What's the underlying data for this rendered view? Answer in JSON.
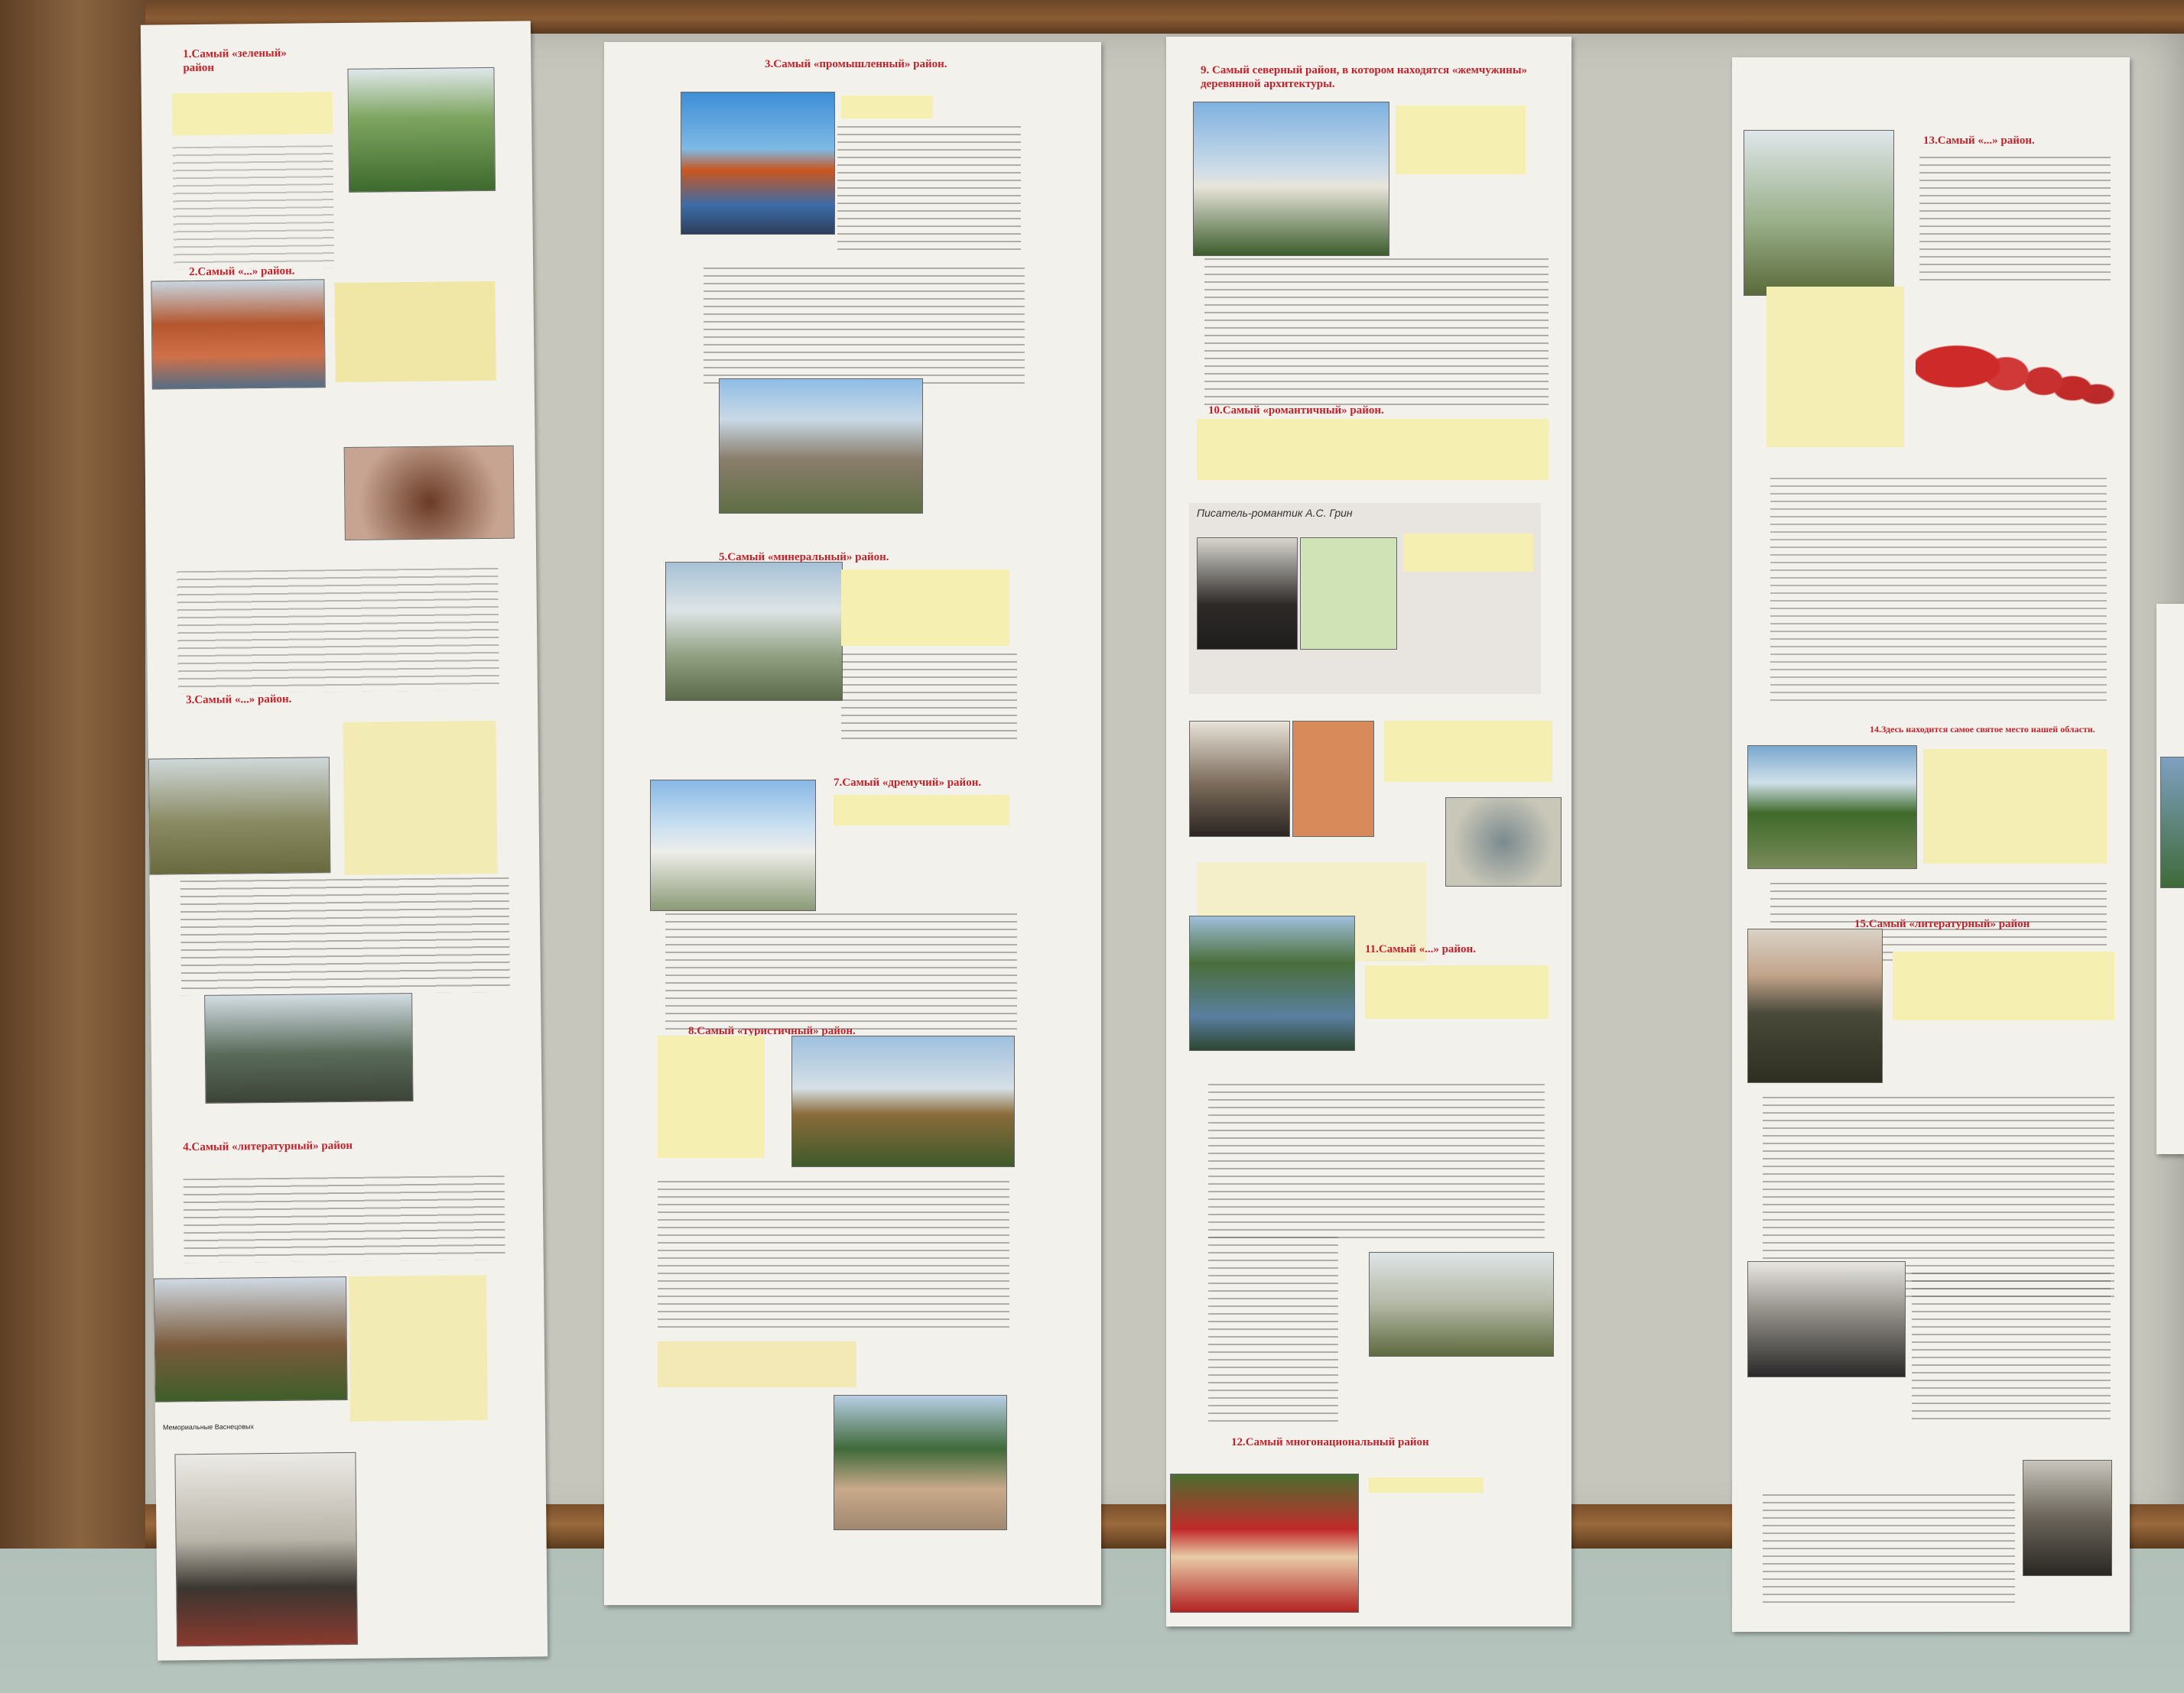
{
  "scene": "photo-of-wall-display",
  "colors": {
    "paper": "#f3f1ec",
    "heading_red": "#c2222b",
    "highlight_yellow": "#f6efb2",
    "wood": "#8a5c33",
    "board": "#c7c6bd"
  },
  "sheets": {
    "col1": {
      "h1": "1.Самый «зеленый» район",
      "h2": "2.Самый «...» район.",
      "h3": "3.Самый «...» район.",
      "h4": "4.Самый «литературный» район",
      "caption": "Мемориальные Васнецовых"
    },
    "col2": {
      "h1": "3.Самый «промышленный» район.",
      "h2": "5.Самый «минеральный» район.",
      "h3": "7.Самый «дремучий» район.",
      "h4": "8.Самый «туристичный» район."
    },
    "col3": {
      "h1": "9. Самый северный район, в котором находятся «жемчужины» деревянной архитектуры.",
      "h2": "10.Самый «романтичный» район.",
      "green_title": "Писатель-романтик А.С. Грин",
      "h3": "11.Самый «...» район.",
      "h4": "12.Самый многонациональный район"
    },
    "col4": {
      "h1": "13.Самый «...» район.",
      "h2": "14.Здесь находится самое святое место нашей области.",
      "h3": "15.Самый «литературный» район"
    }
  }
}
